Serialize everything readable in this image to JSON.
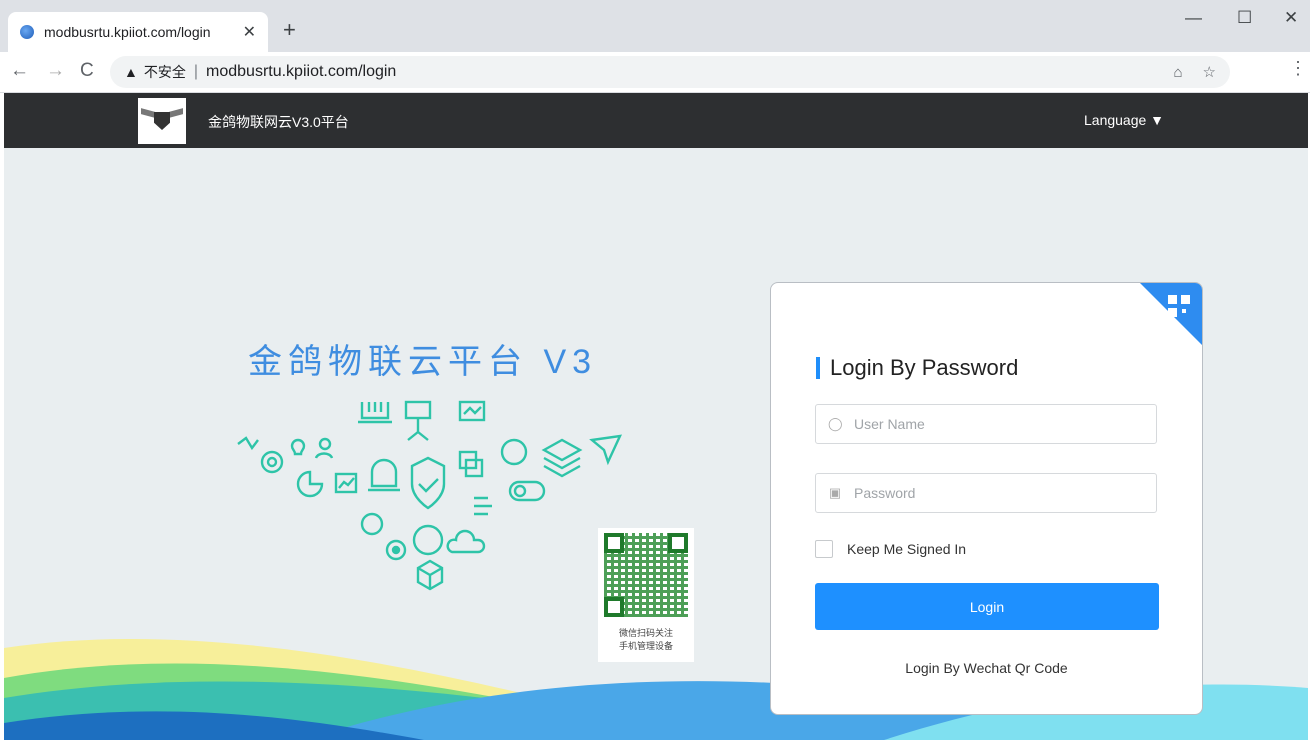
{
  "browser": {
    "tab_title": "modbusrtu.kpiiot.com/login",
    "tab_close": "✕",
    "new_tab": "+",
    "security_label": "不安全",
    "url": "modbusrtu.kpiiot.com/login",
    "window_minimize": "—",
    "window_maximize": "☐",
    "window_close": "✕"
  },
  "site": {
    "name": "金鸽物联网云V3.0平台",
    "language_label": "Language ▼"
  },
  "hero": {
    "title": "金鸽物联云平台 V3"
  },
  "qr": {
    "caption_line1": "微信扫码关注",
    "caption_line2": "手机管理设备"
  },
  "login": {
    "heading": "Login By Password",
    "username_placeholder": "User Name",
    "password_placeholder": "Password",
    "keep_signed_in": "Keep Me Signed In",
    "login_button": "Login",
    "wechat_link": "Login By Wechat Qr Code"
  },
  "colors": {
    "accent": "#1e90ff",
    "nav_bg": "#2d2f31",
    "page_bg": "#e9eef0",
    "icon_teal": "#2ec4a8"
  }
}
